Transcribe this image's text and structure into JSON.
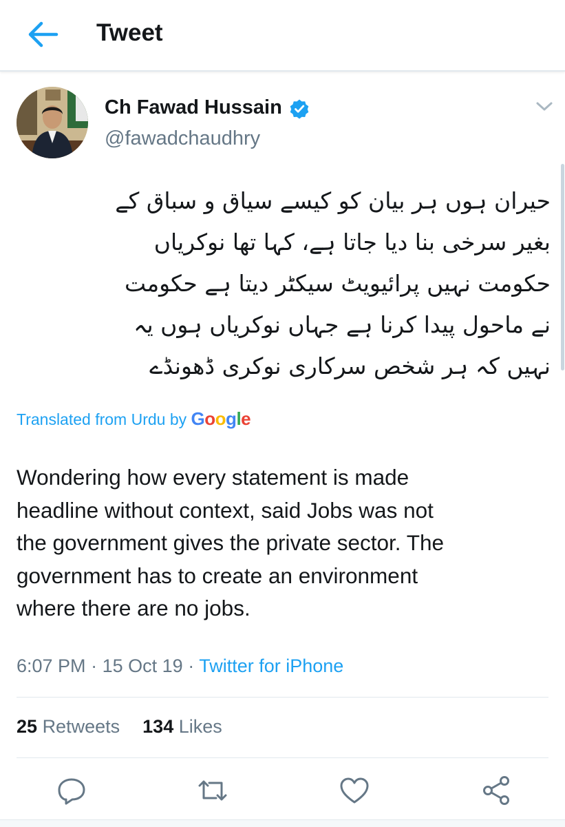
{
  "header": {
    "title": "Tweet"
  },
  "tweet": {
    "author": {
      "name": "Ch Fawad Hussain",
      "handle": "@fawadchaudhry",
      "verified": true
    },
    "urdu_lines": [
      "حیران ہوں ہر بیان کو کیسے سیاق و سباق کے",
      "بغیر سرخی بنا دیا جاتا ہے، کہا تھا نوکریاں",
      "حکومت نہیں پرائیویٹ سیکٹر دیتا ہے حکومت",
      "نے ماحول پیدا کرنا ہے جہاں نوکریاں ہوں یہ",
      "نہیں کہ ہر شخص سرکاری نوکری ڈھونڈے"
    ],
    "translation": {
      "label": "Translated from Urdu by",
      "brand": [
        "G",
        "o",
        "o",
        "g",
        "l",
        "e"
      ],
      "brand_colors": [
        "#4285f4",
        "#ea4335",
        "#fbbc05",
        "#4285f4",
        "#34a853",
        "#ea4335"
      ]
    },
    "english_lines": [
      "Wondering how every statement is made",
      "headline without context, said Jobs was not",
      "the government gives the private sector. The",
      "government has to create an environment",
      "where there are no jobs."
    ],
    "meta": {
      "time": "6:07 PM",
      "separator": "·",
      "date": "15 Oct 19",
      "source": "Twitter for iPhone"
    },
    "stats": {
      "retweets_count": "25",
      "retweets_label": "Retweets",
      "likes_count": "134",
      "likes_label": "Likes"
    }
  },
  "actions": [
    "reply-icon",
    "retweet-icon",
    "like-icon",
    "share-icon"
  ],
  "colors": {
    "accent": "#1da1f2",
    "secondary_text": "#657786",
    "divider": "#e1e8ed"
  }
}
